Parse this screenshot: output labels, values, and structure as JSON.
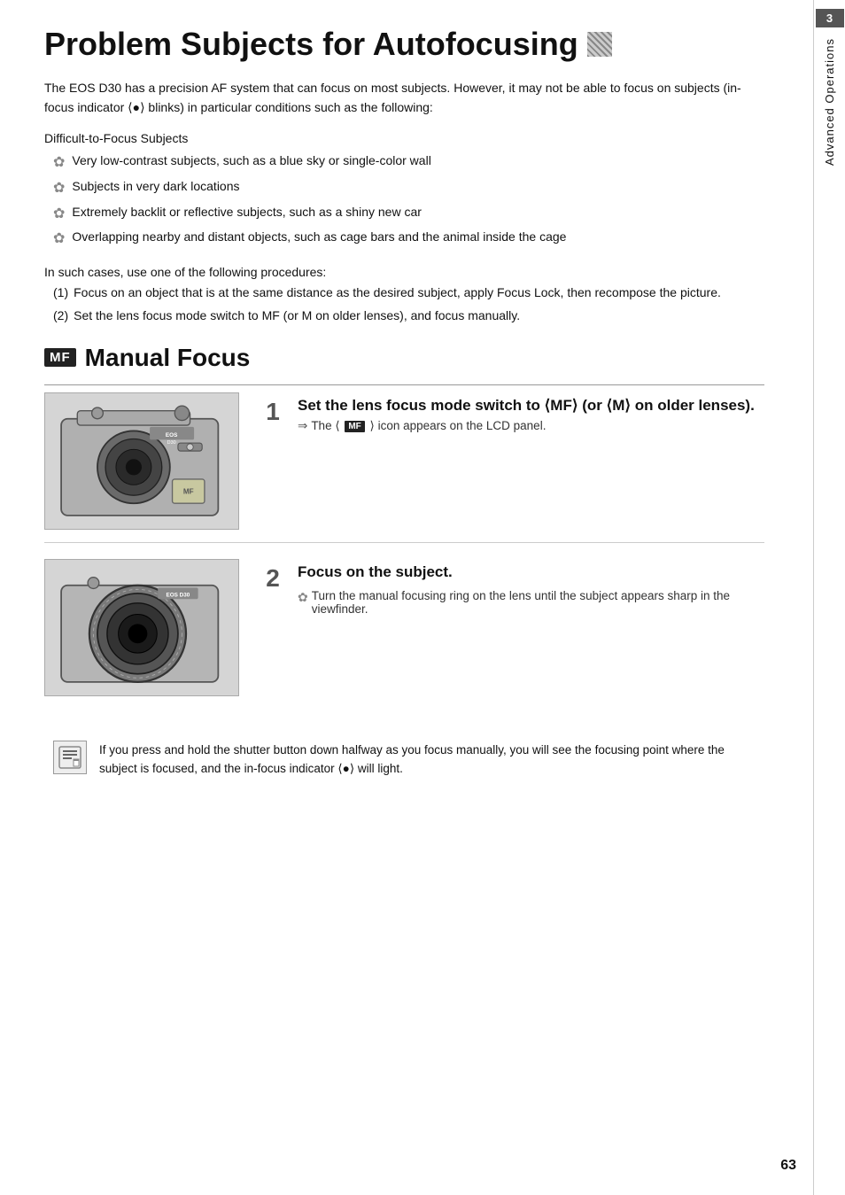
{
  "page": {
    "title": "Problem Subjects for Autofocusing",
    "page_number": "63",
    "intro": "The EOS D30 has a precision AF system that can focus on most subjects. However, it may not be able to focus on subjects (in-focus indicator ⟨●⟩ blinks) in particular conditions such as the following:",
    "difficult_label": "Difficult-to-Focus Subjects",
    "bullets": [
      "Very low-contrast subjects, such as a blue sky or single-color wall",
      "Subjects in very dark locations",
      "Extremely backlit or reflective subjects, such as a shiny new car",
      "Overlapping nearby and distant objects, such as cage bars and the animal inside the cage"
    ],
    "procedures_intro": "In such cases, use one of the following procedures:",
    "procedures": [
      {
        "num": "(1)",
        "text": "Focus on an object that is at the same distance as the desired subject, apply Focus Lock, then recompose the picture."
      },
      {
        "num": "(2)",
        "text": "Set the lens focus mode switch to MF (or M on older lenses), and focus manually."
      }
    ],
    "mf_section": {
      "badge": "MF",
      "title": "Manual Focus",
      "steps": [
        {
          "num": "1",
          "title": "Set the lens focus mode switch to ⟨MF⟩ (or ⟨M⟩ on older lenses).",
          "note": "The ⟨ MF ⟩ icon appears on the LCD panel.",
          "image_alt": "Camera with lens focus mode switch"
        },
        {
          "num": "2",
          "title": "Focus on the subject.",
          "note": "Turn the manual focusing ring on the lens until the subject appears sharp in the viewfinder.",
          "image_alt": "Camera lens manual focus ring"
        }
      ]
    },
    "note_box": {
      "text": "If you press and hold the shutter button down halfway as you focus manually, you will see the focusing point where the subject is focused, and the in-focus indicator ⟨●⟩ will light."
    },
    "sidebar": {
      "number": "3",
      "label": "Advanced Operations"
    }
  }
}
